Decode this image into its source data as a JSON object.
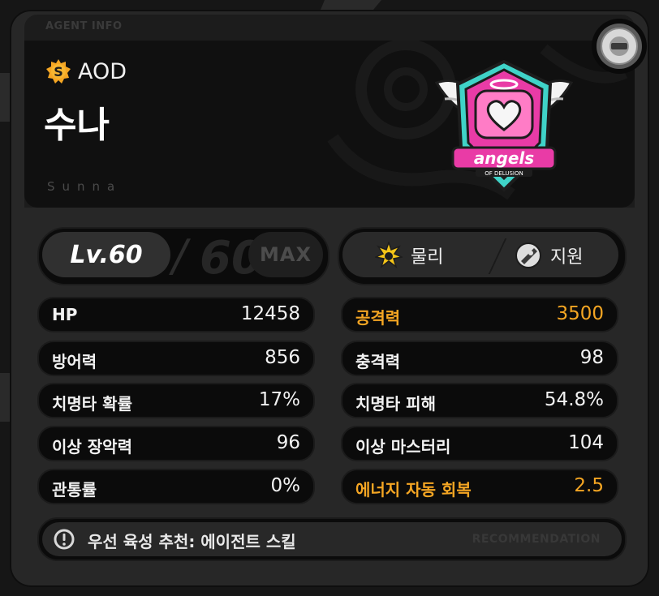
{
  "header": {
    "label": "AGENT INFO",
    "rank_icon": "s-rank-icon",
    "faction": "AOD",
    "agent_name": "수나",
    "agent_romanized": "Sunna",
    "emblem_icon": "angels-of-delusion-emblem",
    "emblem_text": "ANGELS OF DELUSION"
  },
  "level": {
    "current": "Lv.60",
    "max": "60",
    "badge": "MAX"
  },
  "types": [
    {
      "label": "물리",
      "icon": "physical-attribute-icon",
      "color": "#f5c518"
    },
    {
      "label": "지원",
      "icon": "support-specialty-icon",
      "color": "#cfcfcf"
    }
  ],
  "stats_left": [
    {
      "label": "HP",
      "value": "12458",
      "highlight": false
    },
    {
      "label": "방어력",
      "value": "856",
      "highlight": false
    },
    {
      "label": "치명타 확률",
      "value": "17%",
      "highlight": false
    },
    {
      "label": "이상 장악력",
      "value": "96",
      "highlight": false
    },
    {
      "label": "관통률",
      "value": "0%",
      "highlight": false
    }
  ],
  "stats_right": [
    {
      "label": "공격력",
      "value": "3500",
      "highlight": true
    },
    {
      "label": "충격력",
      "value": "98",
      "highlight": false
    },
    {
      "label": "치명타 피해",
      "value": "54.8%",
      "highlight": false
    },
    {
      "label": "이상 마스터리",
      "value": "104",
      "highlight": false
    },
    {
      "label": "에너지 자동 회복",
      "value": "2.5",
      "highlight": true
    }
  ],
  "recommendation": {
    "icon": "exclamation-icon",
    "text": "우선 육성 추천: 에이전트 스킬",
    "tag": "RECOMMENDATION"
  },
  "colors": {
    "highlight": "#f5a623",
    "card_bg": "#272727",
    "pill_bg": "#0b0b0b",
    "emblem_pink": "#e93ba6",
    "emblem_teal": "#3fd3c8"
  }
}
